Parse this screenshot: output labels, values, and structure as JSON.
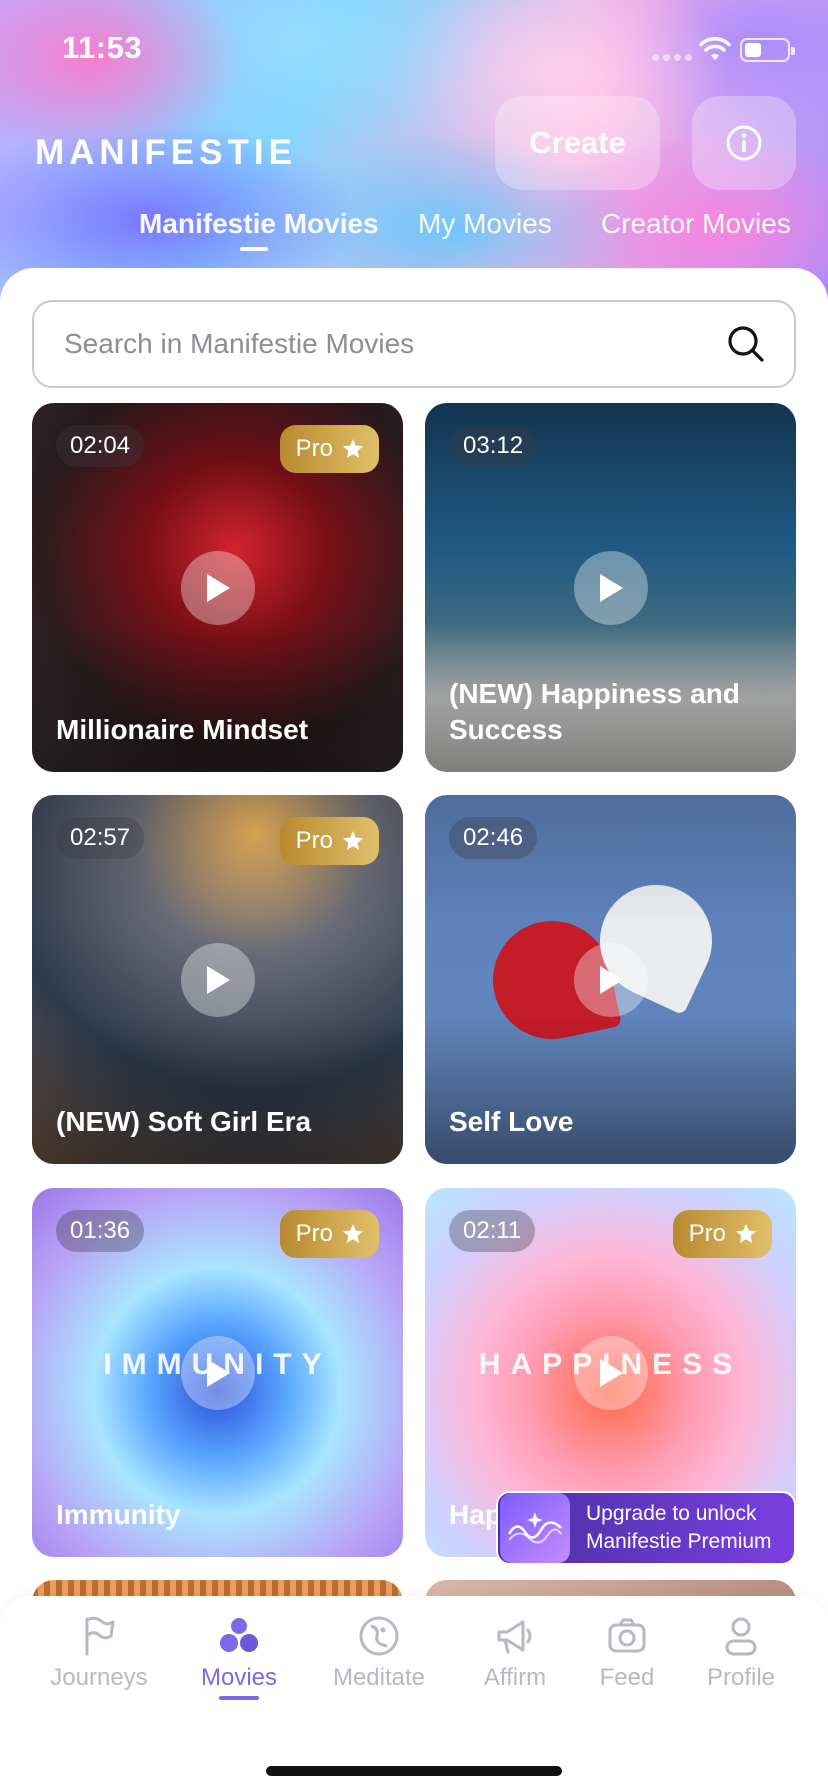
{
  "status": {
    "time": "11:53"
  },
  "header": {
    "logo": "MANIFESTIE",
    "create_label": "Create"
  },
  "tabs": [
    {
      "label": "Manifestie Movies",
      "active": true
    },
    {
      "label": "My Movies",
      "active": false
    },
    {
      "label": "Creator Movies",
      "active": false
    }
  ],
  "search": {
    "placeholder": "Search in Manifestie Movies"
  },
  "pro_label": "Pro",
  "movies": [
    {
      "duration": "02:04",
      "title": "Millionaire Mindset",
      "pro": true
    },
    {
      "duration": "03:12",
      "title": "(NEW) Happiness and Success",
      "pro": false
    },
    {
      "duration": "02:57",
      "title": "(NEW) Soft Girl Era",
      "pro": true
    },
    {
      "duration": "02:46",
      "title": "Self Love",
      "pro": false
    },
    {
      "duration": "01:36",
      "title": "Immunity",
      "pro": true,
      "art_text": "IMMUNITY"
    },
    {
      "duration": "02:11",
      "title": "Hap",
      "pro": true,
      "art_text": "HAPPINESS"
    }
  ],
  "upgrade": {
    "line1": "Upgrade to unlock",
    "line2": "Manifestie Premium"
  },
  "nav": [
    {
      "label": "Journeys",
      "icon": "flag-icon",
      "active": false
    },
    {
      "label": "Movies",
      "icon": "movies-icon",
      "active": true
    },
    {
      "label": "Meditate",
      "icon": "meditate-icon",
      "active": false
    },
    {
      "label": "Affirm",
      "icon": "megaphone-icon",
      "active": false
    },
    {
      "label": "Feed",
      "icon": "camera-icon",
      "active": false
    },
    {
      "label": "Profile",
      "icon": "profile-icon",
      "active": false
    }
  ],
  "colors": {
    "accent": "#7b6ae8",
    "pro_gold": "#c9a04a",
    "inactive_nav": "#b8b8c0"
  }
}
